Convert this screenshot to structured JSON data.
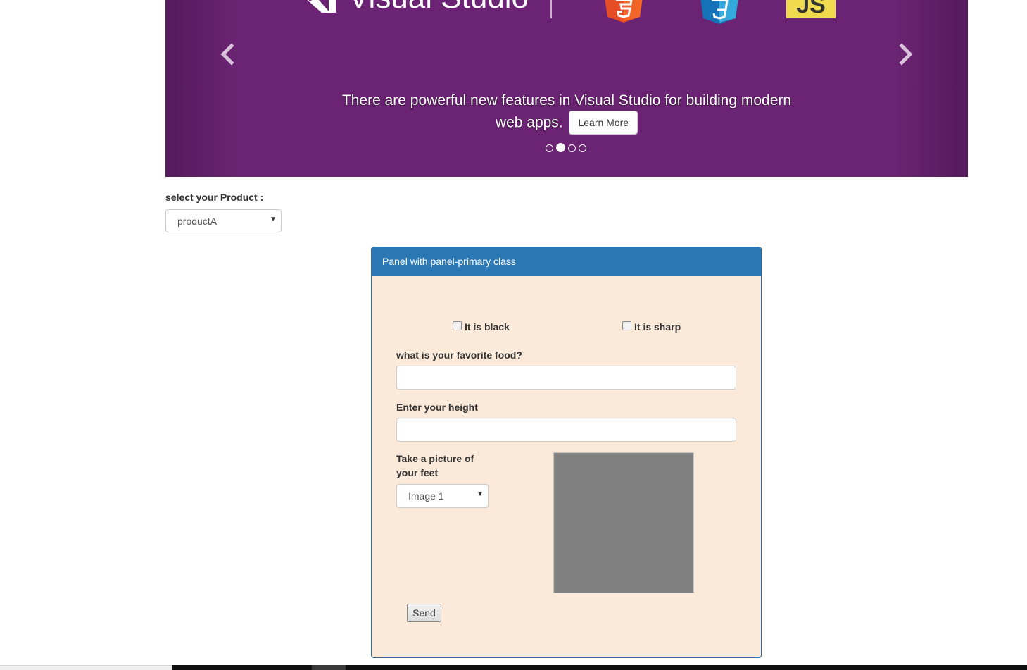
{
  "carousel": {
    "logo_text": "Visual Studio",
    "js_badge": "JS",
    "caption": "There are powerful new features in Visual Studio for building modern web apps.",
    "learn_more": "Learn More",
    "slide_count": 4,
    "active_slide_index": 1,
    "background_color": "#6b2473",
    "icons": {
      "prev": "chevron-left-icon",
      "next": "chevron-right-icon",
      "html5": "html5-icon",
      "css3": "css3-icon"
    }
  },
  "product": {
    "label": "select your Product :",
    "selected": "productA"
  },
  "panel": {
    "title": "Panel with panel-primary class",
    "heading_color": "#2c78b5",
    "body_color": "#fbe9da",
    "checkboxes": [
      {
        "label": "It is black",
        "checked": false
      },
      {
        "label": "It is sharp",
        "checked": false
      }
    ],
    "food_label": "what is your favorite food?",
    "food_value": "",
    "height_label": "Enter your height",
    "height_value": "",
    "photo_label": "Take a picture of your feet",
    "image_selected": "Image 1",
    "send_label": "Send"
  }
}
